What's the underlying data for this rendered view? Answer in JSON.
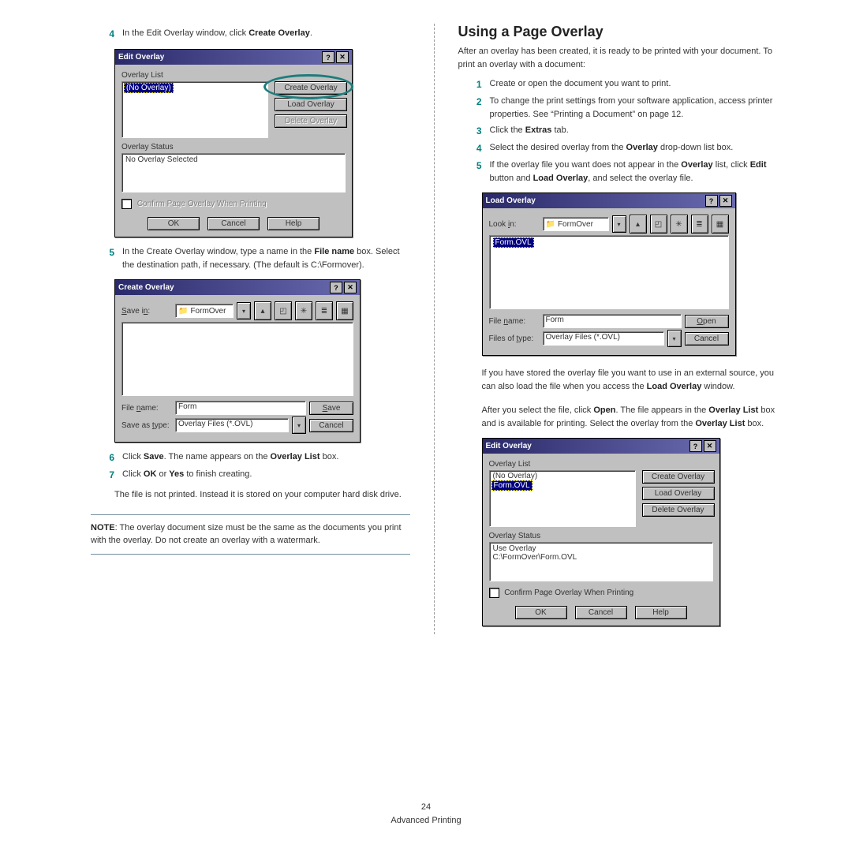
{
  "left": {
    "step4_num": "4",
    "step4_a": "In the Edit Overlay window, click ",
    "step4_b": "Create Overlay",
    "step4_c": ".",
    "step5_num": "5",
    "step5_a": "In the Create Overlay window, type a name in the ",
    "step5_b": "File name",
    "step5_c": " box. Select the destination path, if necessary. (The default is C:\\Formover).",
    "step6_num": "6",
    "step6_a": "Click ",
    "step6_b": "Save",
    "step6_c": ". The name appears on the ",
    "step6_d": "Overlay List",
    "step6_e": " box.",
    "step7_num": "7",
    "step7_a": "Click ",
    "step7_b": "OK",
    "step7_c": " or ",
    "step7_d": "Yes",
    "step7_e": " to finish creating.",
    "step7_para": "The file is not printed. Instead it is stored on your computer hard disk drive.",
    "note_label": "NOTE",
    "note_text": ": The overlay document size must be the same as the documents you print with the overlay. Do not create an overlay with a watermark."
  },
  "right": {
    "title": "Using a Page Overlay",
    "intro": "After an overlay has been created, it is ready to be printed with your document. To print an overlay with a document:",
    "s1_num": "1",
    "s1": "Create or open the document you want to print.",
    "s2_num": "2",
    "s2": "To change the print settings from your software application, access printer properties. See “Printing a Document” on page 12.",
    "s3_num": "3",
    "s3_a": "Click the ",
    "s3_b": "Extras",
    "s3_c": " tab.",
    "s4_num": "4",
    "s4_a": "Select the desired overlay from the ",
    "s4_b": "Overlay",
    "s4_c": " drop-down list box.",
    "s5_num": "5",
    "s5_a": "If the overlay file you want does not appear in the ",
    "s5_b": "Overlay",
    "s5_c": " list, click ",
    "s5_d": "Edit",
    "s5_e": " button and ",
    "s5_f": "Load Overlay",
    "s5_g": ", and select the overlay file.",
    "para_a": "If you have stored the overlay file you want to use in an external source, you can also load the file when you access the ",
    "para_b": "Load Overlay",
    "para_c": " window.",
    "para2_a": "After you select the file, click ",
    "para2_b": "Open",
    "para2_c": ". The file appears in the ",
    "para2_d": "Overlay List",
    "para2_e": " box and is available for printing. Select the overlay from the ",
    "para2_f": "Overlay List",
    "para2_g": " box."
  },
  "dlg_edit": {
    "title": "Edit Overlay",
    "overlay_list_label": "Overlay List",
    "no_overlay": "(No Overlay)",
    "create": "Create Overlay",
    "load": "Load Overlay",
    "delete": "Delete Overlay",
    "status_label": "Overlay Status",
    "status_text": "No Overlay Selected",
    "confirm": "Confirm Page Overlay When Printing",
    "ok": "OK",
    "cancel": "Cancel",
    "help": "Help"
  },
  "dlg_create": {
    "title": "Create Overlay",
    "savein": "Save in:",
    "folder": "FormOver",
    "filename_label": "File name:",
    "filename_value": "Form",
    "saveastype_label": "Save as type:",
    "saveastype_value": "Overlay Files (*.OVL)",
    "save": "Save",
    "cancel": "Cancel"
  },
  "dlg_load": {
    "title": "Load Overlay",
    "lookin": "Look in:",
    "folder": "FormOver",
    "file_item": "Form.OVL",
    "filename_label": "File name:",
    "filename_value": "Form",
    "filesoftype_label": "Files of type:",
    "filesoftype_value": "Overlay Files (*.OVL)",
    "open": "Open",
    "cancel": "Cancel"
  },
  "dlg_edit2": {
    "title": "Edit Overlay",
    "overlay_list_label": "Overlay List",
    "no_overlay": "(No Overlay)",
    "form_item": "Form.OVL",
    "create": "Create Overlay",
    "load": "Load Overlay",
    "delete": "Delete Overlay",
    "status_label": "Overlay Status",
    "status_line1": "Use Overlay",
    "status_line2": "C:\\FormOver\\Form.OVL",
    "confirm": "Confirm Page Overlay When Printing",
    "ok": "OK",
    "cancel": "Cancel",
    "help": "Help"
  },
  "footer": {
    "page": "24",
    "section": "Advanced Printing"
  },
  "icons": {
    "help": "?",
    "close": "✕",
    "down": "▾",
    "up": "▴",
    "folder": "📁",
    "list": "≣",
    "detail": "▦",
    "newf": "✳"
  }
}
